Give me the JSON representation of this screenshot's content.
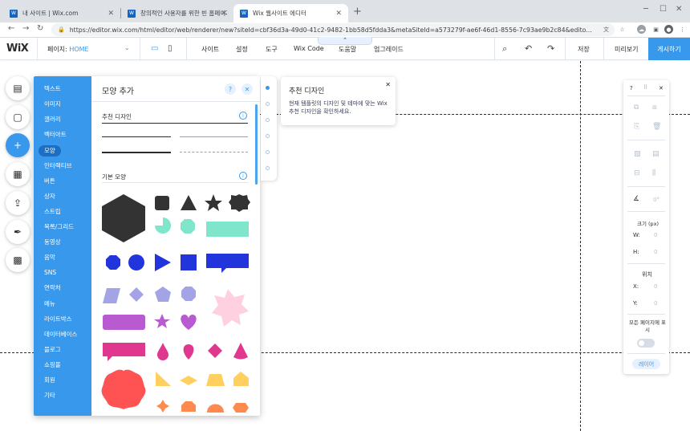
{
  "browser": {
    "tabs": [
      {
        "title": "내 사이트 | Wix.com",
        "active": false
      },
      {
        "title": "창의적인 사용자를 위한 빈 홈페이지",
        "active": false
      },
      {
        "title": "Wix 웹사이트 에디터",
        "active": true
      }
    ],
    "url": "https://editor.wix.com/html/editor/web/renderer/new?siteId=cbf36d3a-49d0-41c2-9482-1bb58d5fdda3&metaSiteId=a573279f-ae6f-46d1-8556-7c93ae9b2c84&edito..."
  },
  "editor": {
    "logo": "WiX",
    "page_label": "페이지:",
    "page_value": "HOME",
    "menu": [
      "사이트",
      "설정",
      "도구",
      "Wix Code",
      "도움말",
      "업그레이드"
    ],
    "save": "저장",
    "preview": "미리보기",
    "publish": "게시하기"
  },
  "add_panel": {
    "title": "모양 추가",
    "categories": [
      "텍스트",
      "이미지",
      "갤러리",
      "벡터아트",
      "모양",
      "인터랙티브",
      "버튼",
      "상자",
      "스트립",
      "목록/그리드",
      "동영상",
      "음악",
      "SNS",
      "연락처",
      "메뉴",
      "라이트박스",
      "데이터베이스",
      "블로그",
      "쇼핑몰",
      "회원",
      "기타"
    ],
    "selected_category": "모양",
    "section_recommended": "추천 디자인",
    "section_basic": "기본 모양"
  },
  "tooltip": {
    "title": "추천 디자인",
    "body": "현재 템플릿의 디자인 및 테마에 맞는 Wix 추천 디자인을 확인하세요."
  },
  "inspector": {
    "help": "?",
    "rotation": "0°",
    "size_label": "크기 (px)",
    "w_label": "W:",
    "w_value": "0",
    "h_label": "H:",
    "h_value": "0",
    "position_label": "위치",
    "x_label": "X:",
    "x_value": "0",
    "y_label": "Y:",
    "y_value": "0",
    "show_all_pages": "모든 페이지에 표시",
    "layer": "레이어"
  },
  "colors": {
    "accent": "#3899ec",
    "dark": "#333333",
    "mint": "#7fe5cb",
    "blue": "#2234dc",
    "lavender": "#a3a3e6",
    "pink_light": "#ffd0e0",
    "purple": "#b85bd0",
    "magenta": "#e0378f",
    "coral": "#ff5252",
    "yellow": "#ffd060",
    "orange": "#ff8a50"
  }
}
